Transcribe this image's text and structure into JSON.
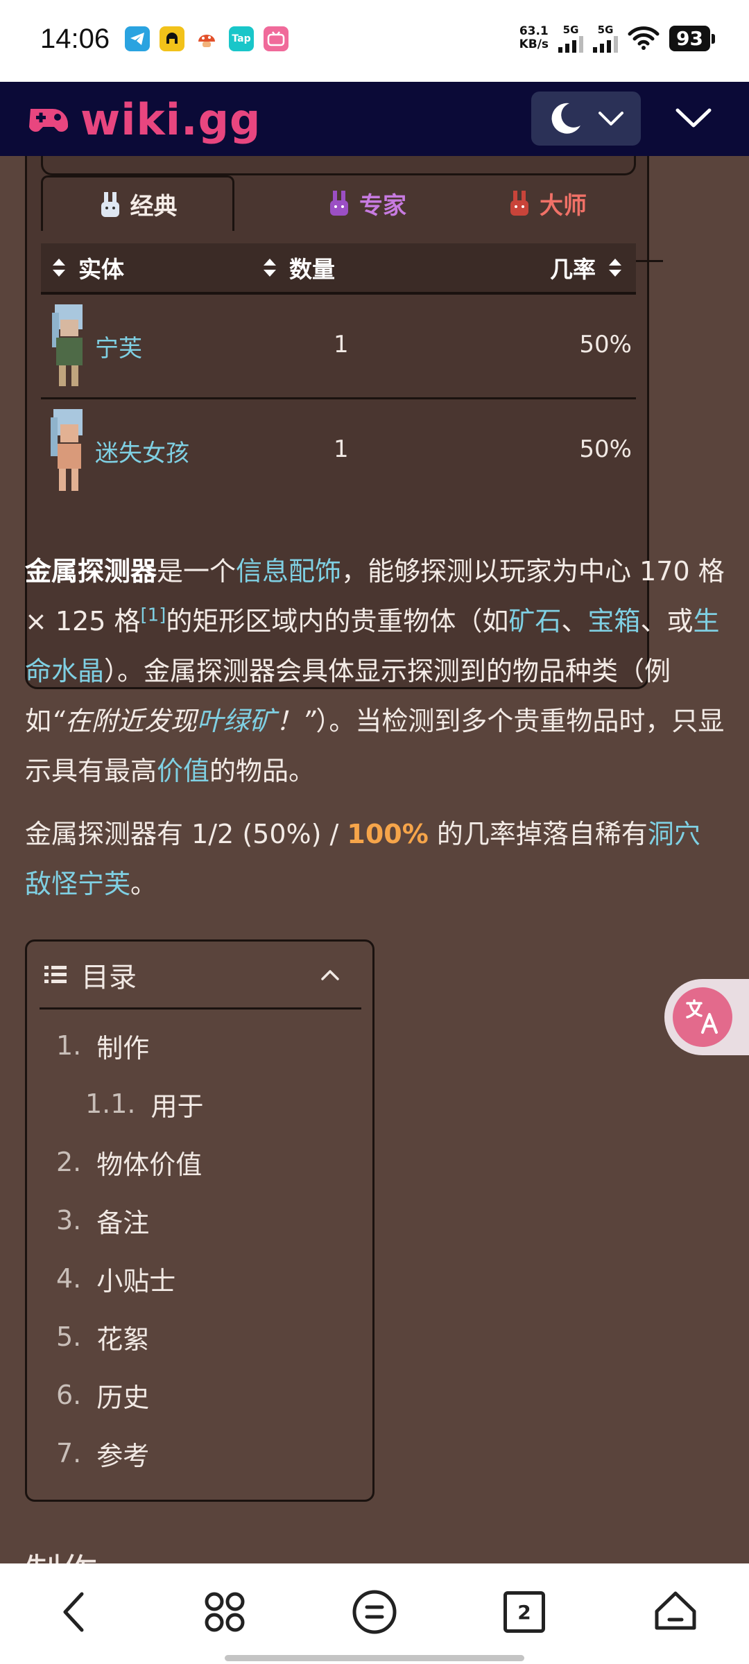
{
  "status_bar": {
    "time": "14:06",
    "net_speed_value": "63.1",
    "net_speed_unit": "KB/s",
    "sim1_label": "5G",
    "sim2_label": "5G",
    "battery": "93",
    "app_icons": [
      "telegram-icon",
      "game-icon",
      "mushroom-icon",
      "taptap-icon",
      "bilibili-icon"
    ],
    "taptap_label": "Tap"
  },
  "header": {
    "logo_text": "wiki.gg",
    "theme_icon": "moon-icon",
    "menu_icon": "chevron-down-icon"
  },
  "infobox": {
    "tabs": [
      {
        "label": "经典",
        "color": "#f5ede8"
      },
      {
        "label": "专家",
        "color": "#c77be0"
      },
      {
        "label": "大师",
        "color": "#f07167"
      }
    ],
    "columns": [
      "实体",
      "数量",
      "几率"
    ],
    "rows": [
      {
        "entity": "宁芙",
        "qty": "1",
        "chance": "50%"
      },
      {
        "entity": "迷失女孩",
        "qty": "1",
        "chance": "50%"
      }
    ]
  },
  "paragraph1": {
    "bold_term": "金属探测器",
    "t1": "是一个",
    "link_accessory": "信息配饰",
    "t2": "，能够探测以玩家为中心 170 格 × 125 格",
    "ref": "[1]",
    "t3": "的矩形区域内的贵重物体（如",
    "link_ore": "矿石",
    "t4": "、",
    "link_chest": "宝箱",
    "t5": "、或",
    "link_crystal": "生命水晶",
    "t6": "）。金属探测器会具体显示探测到的物品种类（例如",
    "quote_a": "“在附近发现",
    "link_chlorophyte": "叶绿矿",
    "quote_b": "！”",
    "t7": "）。当检测到多个贵重物品时，只显示具有最高",
    "link_value": "价值",
    "t8": "的物品。"
  },
  "paragraph2": {
    "t1": "金属探测器有 1/2 (50%) / ",
    "highlight": "100%",
    "t2": " 的几率掉落自稀有",
    "link_enemy": "洞穴敌怪宁芙",
    "t3": "。"
  },
  "toc": {
    "title": "目录",
    "items": [
      {
        "num": "1.",
        "label": "制作"
      },
      {
        "num": "1.1.",
        "label": "用于"
      },
      {
        "num": "2.",
        "label": "物体价值"
      },
      {
        "num": "3.",
        "label": "备注"
      },
      {
        "num": "4.",
        "label": "小贴士"
      },
      {
        "num": "5.",
        "label": "花絮"
      },
      {
        "num": "6.",
        "label": "历史"
      },
      {
        "num": "7.",
        "label": "参考"
      }
    ]
  },
  "next_heading": "制作",
  "bottom_nav": {
    "tab_count": "2",
    "icons": [
      "back-icon",
      "apps-icon",
      "menu-icon",
      "tabs-icon",
      "home-icon"
    ]
  },
  "colors": {
    "background": "#5a443c",
    "link": "#7fd0e3",
    "header_bg": "#0b0a37",
    "logo": "#e8467f",
    "highlight": "#f6a54a"
  }
}
